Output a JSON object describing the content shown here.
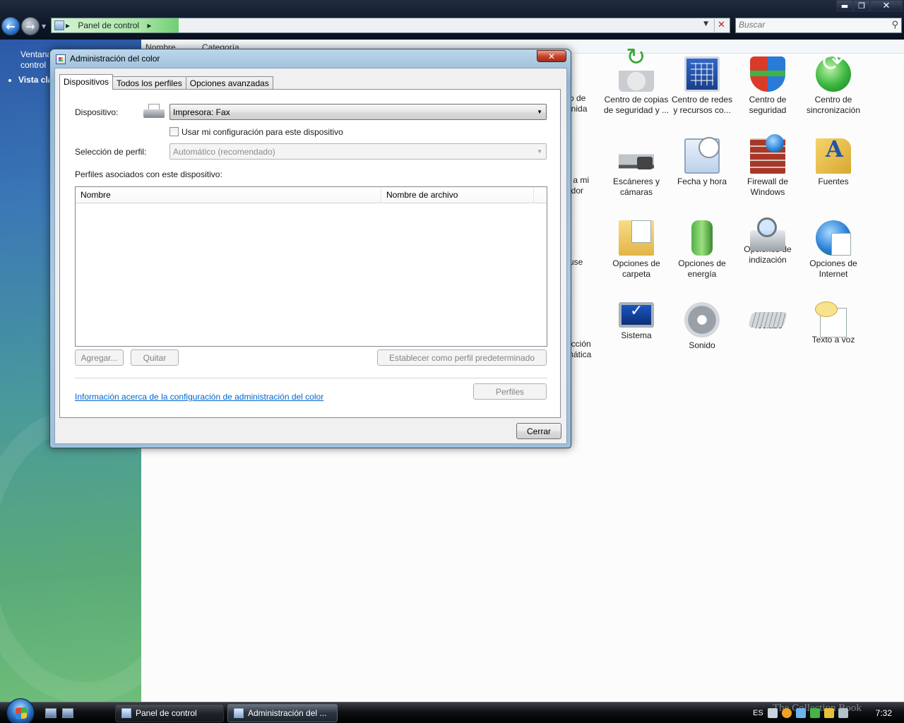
{
  "explorer": {
    "address": {
      "path_label": "Panel de control"
    },
    "search": {
      "placeholder": "Buscar"
    },
    "window_controls": {
      "minimize": "▬",
      "maximize": "❐",
      "close": "✕"
    }
  },
  "left_pane": {
    "text_line1": "Ventana",
    "text_line2": "control",
    "link": "Vista clásica"
  },
  "column_headers": {
    "name": "Nombre",
    "category": "Categoría"
  },
  "control_panel_items": [
    {
      "id": "backup",
      "icon": "backup-icon",
      "label1": "Centro de copias",
      "label2": "de seguridad y ..."
    },
    {
      "id": "network",
      "icon": "network-icon",
      "label1": "Centro de redes",
      "label2": "y recursos co..."
    },
    {
      "id": "security",
      "icon": "shield-icon",
      "label1": "Centro de",
      "label2": "seguridad"
    },
    {
      "id": "sync",
      "icon": "sync-icon",
      "label1": "Centro de",
      "label2": "sincronización"
    },
    {
      "id": "scanners",
      "icon": "scanner-icon",
      "label1": "Escáneres y",
      "label2": "cámaras"
    },
    {
      "id": "datetime",
      "icon": "clock-icon",
      "label1": "Fecha y hora",
      "label2": ""
    },
    {
      "id": "firewall",
      "icon": "firewall-icon",
      "label1": "Firewall de",
      "label2": "Windows"
    },
    {
      "id": "fonts",
      "icon": "fonts-icon",
      "label1": "Fuentes",
      "label2": ""
    },
    {
      "id": "folder",
      "icon": "folder-options-icon",
      "label1": "Opciones de",
      "label2": "carpeta"
    },
    {
      "id": "power",
      "icon": "power-icon",
      "label1": "Opciones de",
      "label2": "energía"
    },
    {
      "id": "index",
      "icon": "indexing-icon",
      "label1": "Opciones de",
      "label2": "indización"
    },
    {
      "id": "internet",
      "icon": "internet-icon",
      "label1": "Opciones de",
      "label2": "Internet"
    },
    {
      "id": "system",
      "icon": "system-icon",
      "label1": "Sistema",
      "label2": ""
    },
    {
      "id": "sound",
      "icon": "sound-icon",
      "label1": "Sonido",
      "label2": ""
    },
    {
      "id": "keyboard",
      "icon": "keyboard-icon",
      "label1": "Teclado",
      "label2": ""
    },
    {
      "id": "tts",
      "icon": "speech-icon",
      "label1": "Texto a voz",
      "label2": ""
    }
  ],
  "partial_items": {
    "row1": "ro de\nenida",
    "row2": "s a mi\nedor",
    "row3": "use",
    "row4": "ucción\nmática"
  },
  "dialog": {
    "title": "Administración del color",
    "close_glyph": "✕",
    "tabs": [
      {
        "label": "Dispositivos",
        "active": true
      },
      {
        "label": "Todos los perfiles",
        "active": false
      },
      {
        "label": "Opciones avanzadas",
        "active": false
      }
    ],
    "device_label": "Dispositivo:",
    "device_value": "Impresora: Fax",
    "use_my_settings_label": "Usar mi configuración para este dispositivo",
    "use_my_settings_checked": false,
    "profile_selection_label": "Selección de perfil:",
    "profile_selection_value": "Automático (recomendado)",
    "associated_profiles_label": "Perfiles asociados con este dispositivo:",
    "columns": {
      "name": "Nombre",
      "filename": "Nombre de archivo"
    },
    "rows": [],
    "buttons": {
      "add": "Agregar...",
      "remove": "Quitar",
      "set_default": "Establecer como perfil predeterminado",
      "profiles": "Perfiles",
      "close": "Cerrar"
    },
    "info_link": "Información acerca de la configuración de administración del color"
  },
  "taskbar": {
    "tasks": [
      {
        "label": "Panel de control",
        "active": false
      },
      {
        "label": "Administración del ...",
        "active": true
      }
    ],
    "language": "ES",
    "watermark": "The Collection Book",
    "clock": "7:32"
  }
}
